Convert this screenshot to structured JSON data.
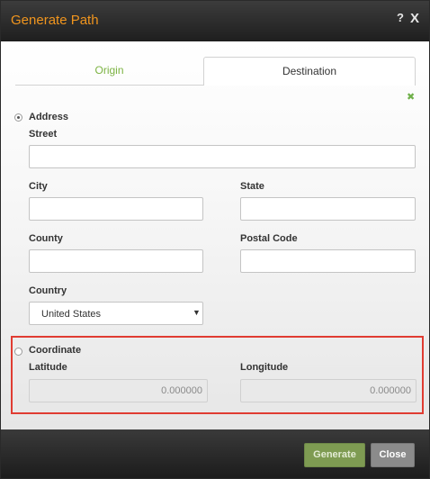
{
  "dialog": {
    "title": "Generate Path",
    "help_glyph": "?",
    "close_glyph": "X"
  },
  "tabs": [
    {
      "label": "Origin",
      "active": false
    },
    {
      "label": "Destination",
      "active": true
    }
  ],
  "add_glyph": "✖",
  "address": {
    "heading": "Address",
    "selected": true,
    "street": {
      "label": "Street",
      "value": ""
    },
    "city": {
      "label": "City",
      "value": ""
    },
    "state": {
      "label": "State",
      "value": ""
    },
    "county": {
      "label": "County",
      "value": ""
    },
    "postal_code": {
      "label": "Postal Code",
      "value": ""
    },
    "country": {
      "label": "Country",
      "value": "United States",
      "arrow": "▼"
    }
  },
  "coordinate": {
    "heading": "Coordinate",
    "selected": false,
    "latitude": {
      "label": "Latitude",
      "value": "0.000000"
    },
    "longitude": {
      "label": "Longitude",
      "value": "0.000000"
    }
  },
  "footer": {
    "generate_label": "Generate",
    "close_label": "Close"
  },
  "colors": {
    "title": "#f0951e",
    "origin_tab": "#7cb342",
    "generate_button": "#7e9b52",
    "highlight_border": "#e03c32"
  }
}
